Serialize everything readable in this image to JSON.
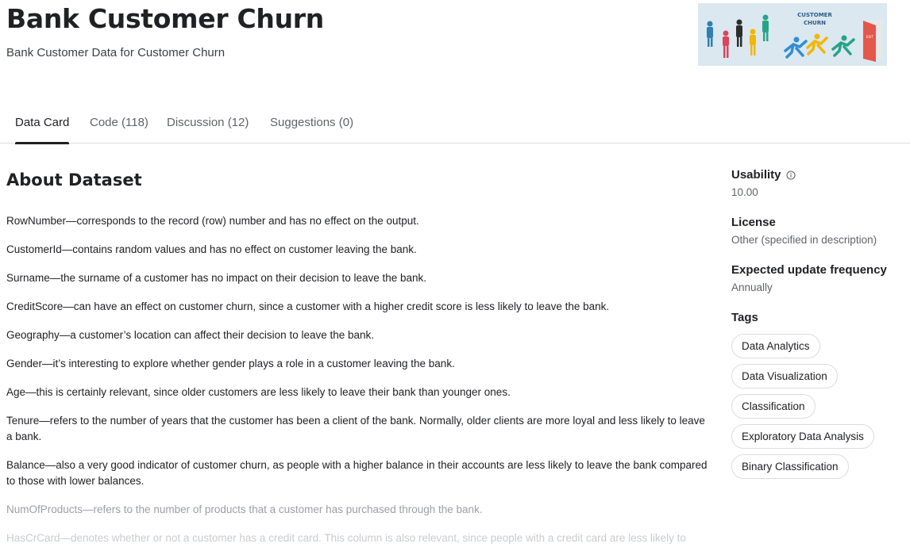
{
  "header": {
    "title": "Bank Customer Churn",
    "subtitle": "Bank Customer Data for Customer Churn",
    "banner": {
      "line1": "CUSTOMER",
      "line2": "CHURN",
      "door_sign": "EXIT"
    }
  },
  "tabs": [
    {
      "label": "Data Card",
      "active": true
    },
    {
      "label": "Code (118)",
      "active": false
    },
    {
      "label": "Discussion (12)",
      "active": false
    },
    {
      "label": "Suggestions (0)",
      "active": false
    }
  ],
  "about": {
    "heading": "About Dataset",
    "paragraphs": [
      "RowNumber—corresponds to the record (row) number and has no effect on the output.",
      "CustomerId—contains random values and has no effect on customer leaving the bank.",
      "Surname—the surname of a customer has no impact on their decision to leave the bank.",
      "CreditScore—can have an effect on customer churn, since a customer with a higher credit score is less likely to leave the bank.",
      "Geography—a customer’s location can affect their decision to leave the bank.",
      "Gender—it’s interesting to explore whether gender plays a role in a customer leaving the bank.",
      "Age—this is certainly relevant, since older customers are less likely to leave their bank than younger ones.",
      "Tenure—refers to the number of years that the customer has been a client of the bank. Normally, older clients are more loyal and less likely to leave a bank.",
      "Balance—also a very good indicator of customer churn, as people with a higher balance in their accounts are less likely to leave the bank compared to those with lower balances.",
      "NumOfProducts—refers to the number of products that a customer has purchased through the bank.",
      "HasCrCard—denotes whether or not a customer has a credit card. This column is also relevant, since people with a credit card are less likely to"
    ]
  },
  "sidebar": {
    "usability_label": "Usability",
    "usability_value": "10.00",
    "license_label": "License",
    "license_value": "Other (specified in description)",
    "frequency_label": "Expected update frequency",
    "frequency_value": "Annually",
    "tags_label": "Tags",
    "tags": [
      "Data Analytics",
      "Data Visualization",
      "Classification",
      "Exploratory Data Analysis",
      "Binary Classification"
    ]
  },
  "colors": {
    "banner_bg": "#dbe8ef",
    "active_tab_underline": "#202124",
    "tag_border": "#dadce0"
  },
  "icons": [
    "info-icon"
  ]
}
